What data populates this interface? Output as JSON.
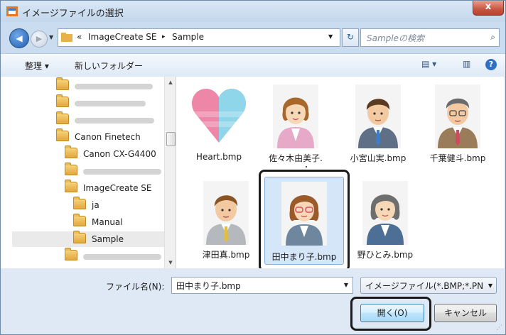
{
  "window": {
    "title": "イメージファイルの選択",
    "close_label": "x"
  },
  "address": {
    "back_icon": "back-arrow-icon",
    "forward_icon": "forward-arrow-icon",
    "prefix": "«",
    "crumbs": [
      "ImageCreate SE",
      "Sample"
    ],
    "separator": "▸",
    "refresh_glyph": "⁴ʸ",
    "search_placeholder": "Sampleの検索"
  },
  "toolbar": {
    "organize_label": "整理 ▾",
    "new_folder_label": "新しいフォルダー",
    "view_icon": "view-options-icon",
    "preview_icon": "preview-pane-icon",
    "help_icon": "help-icon"
  },
  "tree": {
    "items": [
      {
        "label": "",
        "blurred": true
      },
      {
        "label": "",
        "blurred": true
      },
      {
        "label": "",
        "blurred": true
      },
      {
        "label": "Canon Finetech",
        "blurred": false
      },
      {
        "label": "Canon CX-G4400",
        "blurred": false
      },
      {
        "label": "",
        "blurred": true
      },
      {
        "label": "ImageCreate SE",
        "blurred": false
      },
      {
        "label": "ja",
        "blurred": false
      },
      {
        "label": "Manual",
        "blurred": false
      },
      {
        "label": "Sample",
        "blurred": false,
        "selected": true
      },
      {
        "label": "",
        "blurred": true
      }
    ]
  },
  "files": [
    {
      "name": "Heart.bmp",
      "kind": "heart"
    },
    {
      "name": "佐々木由美子.",
      "kind": "woman-pink"
    },
    {
      "name": "小宮山実.bmp",
      "kind": "man-blue"
    },
    {
      "name": "千葉健斗.bmp",
      "kind": "man-glasses"
    },
    {
      "name": "津田真.bmp",
      "kind": "man-yellow"
    },
    {
      "name": "田中まり子.bmp",
      "kind": "woman-glasses",
      "selected": true
    },
    {
      "name": "野ひとみ.bmp",
      "kind": "woman-gray"
    }
  ],
  "footer": {
    "filename_label": "ファイル名(N):",
    "filename_value": "田中まり子.bmp",
    "filetype_value": "イメージファイル(*.BMP;*.PN",
    "open_label": "開く(O)",
    "cancel_label": "キャンセル"
  }
}
